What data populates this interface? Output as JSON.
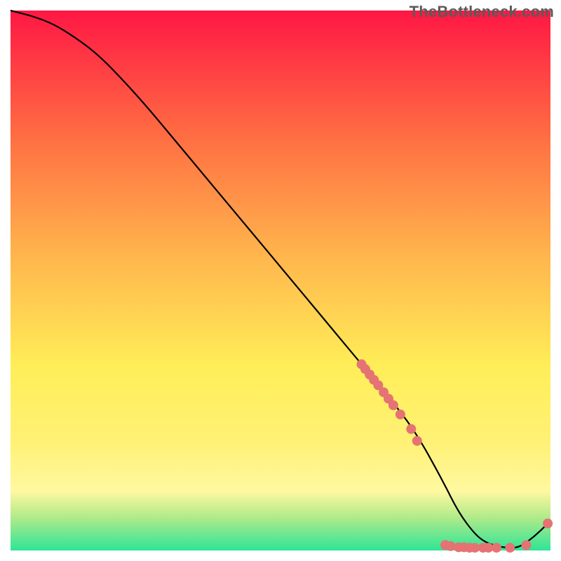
{
  "watermark": "TheBottleneck.com",
  "colors": {
    "curve": "#000000",
    "dots": "#e57373",
    "gradient_top": "#ff1744",
    "gradient_mid1": "#ff7043",
    "gradient_mid2": "#ffb74d",
    "gradient_mid3": "#ffee58",
    "gradient_mid4": "#fff176",
    "gradient_bottom1": "#aeea8a",
    "gradient_bottom2": "#2ee597"
  },
  "chart_data": {
    "type": "line",
    "title": "",
    "xlabel": "",
    "ylabel": "",
    "xlim": [
      0,
      100
    ],
    "ylim": [
      0,
      100
    ],
    "curve": {
      "x": [
        0,
        4,
        8,
        12,
        16,
        20,
        25,
        30,
        35,
        40,
        45,
        50,
        55,
        60,
        65,
        70,
        75,
        80,
        83,
        86,
        88,
        90,
        92,
        94,
        96,
        98,
        100
      ],
      "y": [
        100,
        99,
        97.5,
        95,
        92,
        88,
        82.5,
        76.5,
        70.5,
        64.5,
        58.5,
        52.5,
        46.5,
        40.5,
        34.5,
        28.5,
        22,
        13,
        7,
        3,
        1.5,
        0.8,
        0.5,
        0.5,
        1.8,
        3.5,
        5.5
      ]
    },
    "dots": [
      {
        "x": 65.0,
        "y": 34.5
      },
      {
        "x": 65.7,
        "y": 33.6
      },
      {
        "x": 66.5,
        "y": 32.6
      },
      {
        "x": 67.3,
        "y": 31.6
      },
      {
        "x": 68.1,
        "y": 30.6
      },
      {
        "x": 69.1,
        "y": 29.3
      },
      {
        "x": 70.0,
        "y": 28.1
      },
      {
        "x": 70.9,
        "y": 26.9
      },
      {
        "x": 72.2,
        "y": 25.2
      },
      {
        "x": 74.2,
        "y": 22.5
      },
      {
        "x": 75.3,
        "y": 20.3
      },
      {
        "x": 80.5,
        "y": 1.0
      },
      {
        "x": 81.5,
        "y": 0.8
      },
      {
        "x": 83.0,
        "y": 0.6
      },
      {
        "x": 84.0,
        "y": 0.6
      },
      {
        "x": 85.0,
        "y": 0.5
      },
      {
        "x": 86.0,
        "y": 0.5
      },
      {
        "x": 87.5,
        "y": 0.5
      },
      {
        "x": 88.5,
        "y": 0.5
      },
      {
        "x": 90.0,
        "y": 0.5
      },
      {
        "x": 92.5,
        "y": 0.5
      },
      {
        "x": 95.5,
        "y": 1.0
      },
      {
        "x": 99.5,
        "y": 5.0
      }
    ]
  }
}
